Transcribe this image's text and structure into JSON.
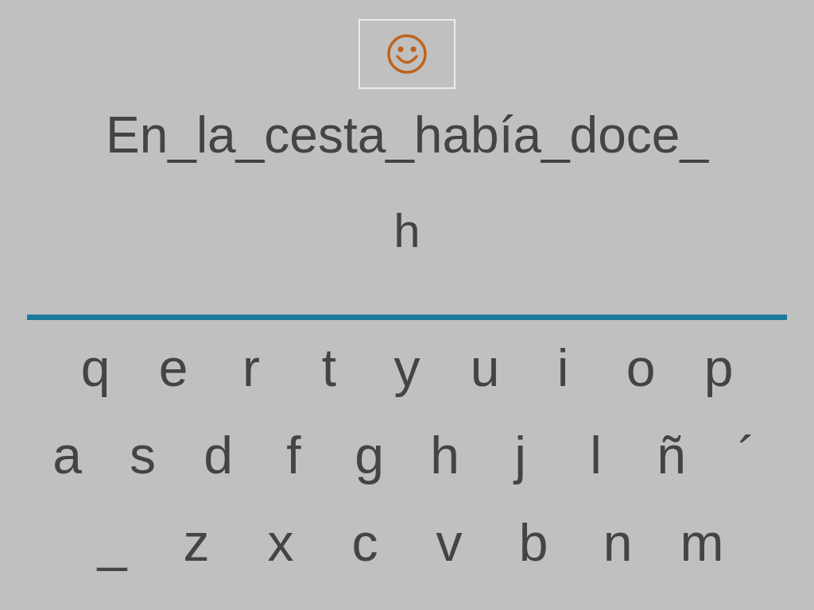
{
  "sentence": "En_la_cesta_había_doce_",
  "answer": "h",
  "keyboard": [
    [
      "q",
      "e",
      "r",
      "t",
      "y",
      "u",
      "i",
      "o",
      "p"
    ],
    [
      "a",
      "s",
      "d",
      "f",
      "g",
      "h",
      "j",
      "l",
      "ñ",
      "´"
    ],
    [
      "_",
      "z",
      "x",
      "c",
      "v",
      "b",
      "n",
      "m"
    ]
  ]
}
